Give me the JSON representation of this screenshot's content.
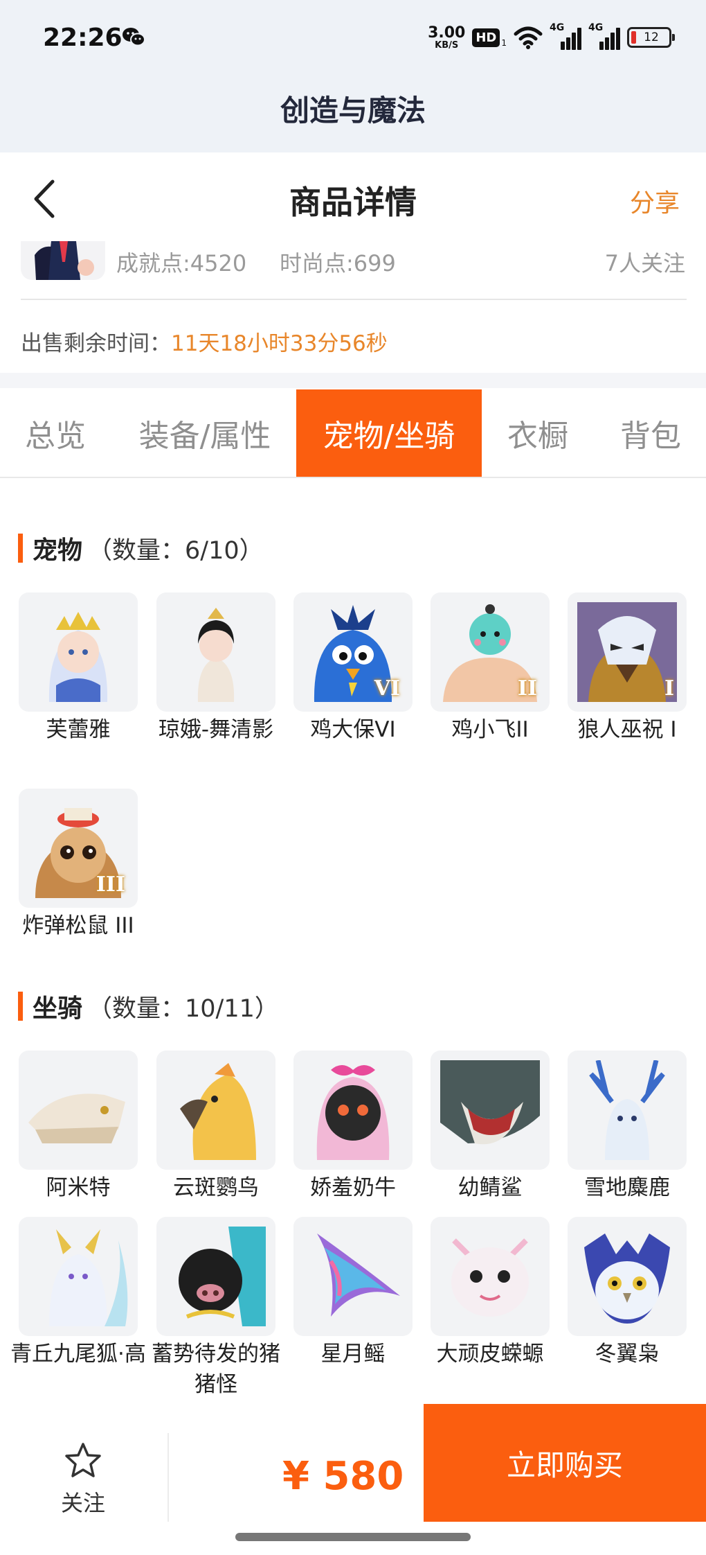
{
  "status_bar": {
    "time": "22:26",
    "net_speed_value": "3.00",
    "net_speed_unit": "KB/S",
    "hd_label": "HD",
    "hd_sub": "1",
    "sim1_label": "4G",
    "sim2_label": "4G",
    "battery": "12",
    "icons": [
      "wechat-icon",
      "wifi-icon",
      "signal-icon",
      "battery-icon"
    ]
  },
  "app_bar": {
    "title": "创造与魔法"
  },
  "page_header": {
    "title": "商品详情",
    "share_label": "分享"
  },
  "info": {
    "achievement": "成就点:4520",
    "fashion": "时尚点:699",
    "followers": "7人关注",
    "remain_label": "出售剩余时间：",
    "remain_time": "11天18小时33分56秒"
  },
  "tabs": [
    {
      "label": "总览"
    },
    {
      "label": "装备/属性"
    },
    {
      "label": "宠物/坐骑",
      "active": true
    },
    {
      "label": "衣橱"
    },
    {
      "label": "背包"
    }
  ],
  "pets": {
    "title": "宠物",
    "count": "（数量：6/10）",
    "items": [
      {
        "name": "芙蕾雅",
        "badge": ""
      },
      {
        "name": "琼娥-舞清影",
        "badge": ""
      },
      {
        "name": "鸡大保VI",
        "badge": "VI"
      },
      {
        "name": "鸡小飞II",
        "badge": "II"
      },
      {
        "name": "狼人巫祝 I",
        "badge": "I"
      },
      {
        "name": "炸弹松鼠 III",
        "badge": "III"
      }
    ]
  },
  "mounts": {
    "title": "坐骑",
    "count": "（数量：10/11）",
    "items": [
      {
        "name": "阿米特"
      },
      {
        "name": "云斑鹦鸟"
      },
      {
        "name": "娇羞奶牛"
      },
      {
        "name": "幼鲭鲨"
      },
      {
        "name": "雪地麋鹿"
      },
      {
        "name": "青丘九尾狐·高"
      },
      {
        "name": "蓄势待发的猪猪怪"
      },
      {
        "name": "星月鳐"
      },
      {
        "name": "大顽皮蝾螈"
      },
      {
        "name": "冬翼枭"
      }
    ]
  },
  "bottom_bar": {
    "follow_label": "关注",
    "price": "¥ 580",
    "buy_label": "立即购买"
  },
  "colors": {
    "accent": "#fb5e0f",
    "orange_text": "#e8862a",
    "app_bg": "#eef2f7"
  }
}
